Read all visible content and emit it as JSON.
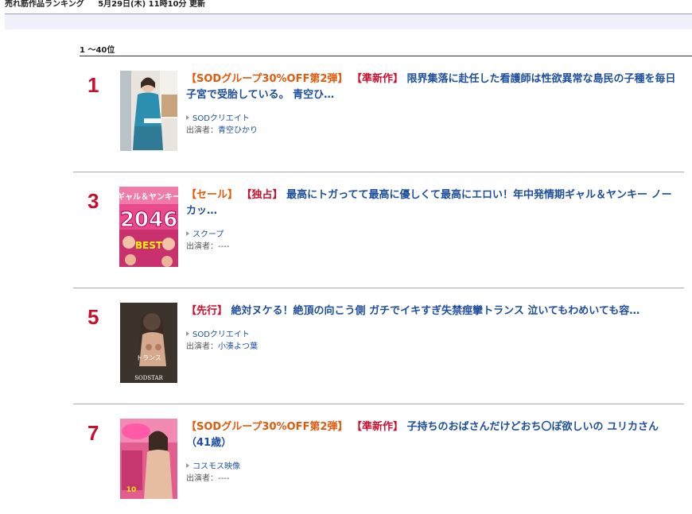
{
  "header": {
    "title": "売れ筋作品ランキング",
    "updated": "5月29日(木) 11時10分 更新"
  },
  "range_label": "1 〜40位",
  "items": [
    {
      "rank": "1",
      "tag1": "【SODグループ30%OFF第2弾】",
      "tag2": "【準新作】",
      "title": "限界集落に赴任した看護師は性欲異常な島民の子種を毎日子宮で受胎している。 青空ひ…",
      "maker": "SODクリエイト",
      "cast_label": "出演者：",
      "cast": "青空ひかり"
    },
    {
      "rank": "3",
      "tag1": "【セール】",
      "tag2": "【独占】",
      "title": "最高にトガってて最高に優しくて最高にエロい！年中発情期ギャル＆ヤンキー ノーカッ…",
      "maker": "スクープ",
      "cast_label": "出演者：",
      "cast": "----",
      "thumb_text": {
        "line1": "ギャル＆ヤンキー",
        "line2": "2046",
        "line3": "BEST"
      }
    },
    {
      "rank": "5",
      "tag1": "",
      "tag2": "【先行】",
      "title": "絶対ヌケる！絶頂の向こう側 ガチでイキすぎ失禁痙攣トランス 泣いてもわめいても容…",
      "maker": "SODクリエイト",
      "cast_label": "出演者：",
      "cast": "小湊よつ葉",
      "thumb_text": {
        "line1": "トランス",
        "line2": "SODSTAR"
      }
    },
    {
      "rank": "7",
      "tag1": "【SODグループ30%OFF第2弾】",
      "tag2": "【準新作】",
      "title": "子持ちのおばさんだけどおち〇ぽ欲しいの ユリカさん（41歳）",
      "maker": "コスモス映像",
      "cast_label": "出演者：",
      "cast": "----",
      "thumb_text": {
        "line1": "10"
      }
    }
  ]
}
